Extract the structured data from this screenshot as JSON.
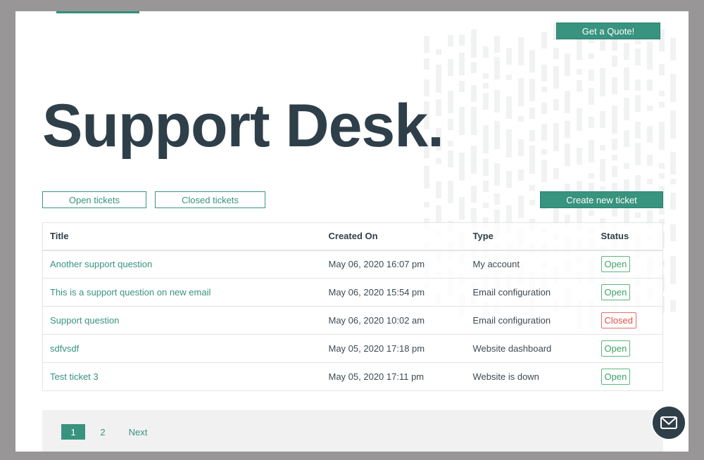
{
  "header": {
    "quote_button": "Get a Quote!",
    "title": "Support Desk."
  },
  "filters": {
    "open_label": "Open tickets",
    "closed_label": "Closed tickets",
    "create_label": "Create new ticket"
  },
  "table": {
    "columns": [
      "Title",
      "Created On",
      "Type",
      "Status"
    ],
    "rows": [
      {
        "title": "Another support question",
        "created": "May 06, 2020 16:07 pm",
        "type": "My account",
        "status": "Open"
      },
      {
        "title": "This is a support question on new email",
        "created": "May 06, 2020 15:54 pm",
        "type": "Email configuration",
        "status": "Open"
      },
      {
        "title": "Support question",
        "created": "May 06, 2020 10:02 am",
        "type": "Email configuration",
        "status": "Closed"
      },
      {
        "title": "sdfvsdf",
        "created": "May 05, 2020 17:18 pm",
        "type": "Website dashboard",
        "status": "Open"
      },
      {
        "title": "Test ticket 3",
        "created": "May 05, 2020 17:11 pm",
        "type": "Website is down",
        "status": "Open"
      }
    ]
  },
  "pagination": {
    "pages": [
      "1",
      "2"
    ],
    "current": "1",
    "next_label": "Next"
  },
  "fab": {
    "icon": "mail-icon"
  },
  "colors": {
    "accent": "#38937f",
    "title_text": "#2f3f49",
    "status_open": "#3ca466",
    "status_closed": "#e0504a",
    "backdrop": "#989696"
  }
}
